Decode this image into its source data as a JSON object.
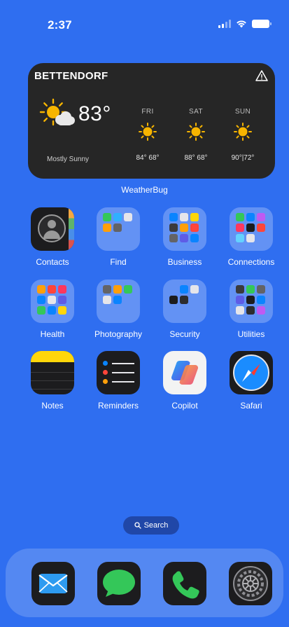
{
  "status_bar": {
    "time": "2:37"
  },
  "weather_widget": {
    "city": "BETTENDORF",
    "current_temp": "83°",
    "condition": "Mostly Sunny",
    "forecast": [
      {
        "day": "FRI",
        "temps": "84° 68°"
      },
      {
        "day": "SAT",
        "temps": "88° 68°"
      },
      {
        "day": "SUN",
        "temps": "90°|72°"
      }
    ],
    "caption": "WeatherBug"
  },
  "apps": [
    {
      "label": "Contacts"
    },
    {
      "label": "Find"
    },
    {
      "label": "Business"
    },
    {
      "label": "Connections"
    },
    {
      "label": "Health"
    },
    {
      "label": "Photography"
    },
    {
      "label": "Security"
    },
    {
      "label": "Utilities"
    },
    {
      "label": "Notes"
    },
    {
      "label": "Reminders"
    },
    {
      "label": "Copilot"
    },
    {
      "label": "Safari"
    }
  ],
  "search": {
    "label": "Search"
  },
  "dock": [
    {
      "icon": "mail-icon"
    },
    {
      "icon": "messages-icon"
    },
    {
      "icon": "phone-icon"
    },
    {
      "icon": "settings-icon"
    }
  ],
  "colors": {
    "wallpaper": "#2f6ef0",
    "widget_bg": "#262626",
    "sun": "#f7b500"
  }
}
